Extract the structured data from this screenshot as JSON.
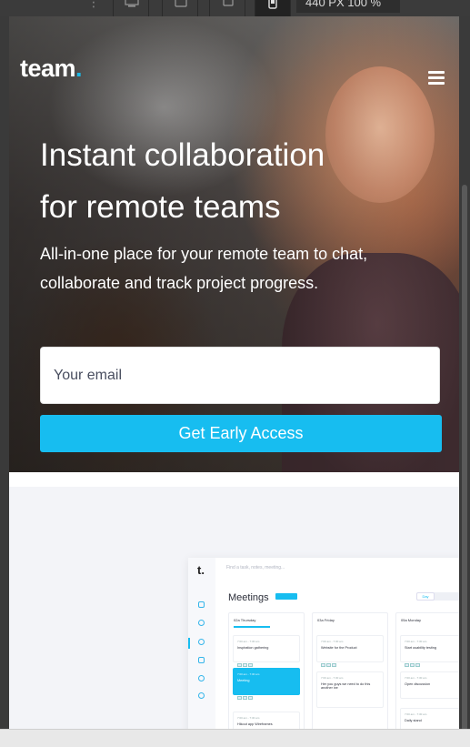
{
  "devtools": {
    "size_readout": "440 PX 100 %",
    "device_icons": [
      "desktop-icon",
      "tablet-landscape-icon",
      "laptop-icon",
      "mobile-icon"
    ],
    "active_device": "mobile-icon"
  },
  "brand": {
    "logo_text": "team",
    "logo_dot": ".",
    "accent_color": "#17bdf0"
  },
  "header": {
    "menu_icon": "hamburger-menu-icon"
  },
  "hero": {
    "headline_line1": "Instant collaboration",
    "headline_line2": "for remote teams",
    "subline": "All-in-one place for your remote team to chat, collaborate and track project progress."
  },
  "signup": {
    "email_placeholder": "Your email",
    "email_value": "",
    "cta_label": "Get Early Access"
  },
  "app_preview": {
    "logo": "t.",
    "search_placeholder": "Find a task, notes, meeting...",
    "title": "Meetings",
    "view_toggle": [
      "Day",
      "Week",
      "Month"
    ],
    "columns": [
      {
        "header": "02a Thursday",
        "cards": [
          {
            "time": "7:00 am - 7:30 am",
            "title": "Inspiration gathering",
            "highlighted": false
          },
          {
            "time": "7:00 am - 7:30 am",
            "title": "Meeting",
            "highlighted": true
          },
          {
            "time": "7:00 am - 7:30 am",
            "title": "Hikout app Wireframes",
            "highlighted": false
          }
        ]
      },
      {
        "header": "03a Friday",
        "cards": [
          {
            "time": "7:00 am - 7:30 am",
            "title": "Website for the Product",
            "highlighted": false
          },
          {
            "time": "7:00 am - 7:30 am",
            "title": "Her you guys we need to do this another ixe",
            "highlighted": false
          }
        ]
      },
      {
        "header": "05a Monday",
        "cards": [
          {
            "time": "7:00 am - 7:30 am",
            "title": "Start usability testing",
            "highlighted": false
          },
          {
            "time": "7:00 am - 7:30 am",
            "title": "Open discussion",
            "highlighted": false
          },
          {
            "time": "7:00 am - 7:30 am",
            "title": "Daily stand",
            "highlighted": false
          }
        ]
      }
    ]
  }
}
